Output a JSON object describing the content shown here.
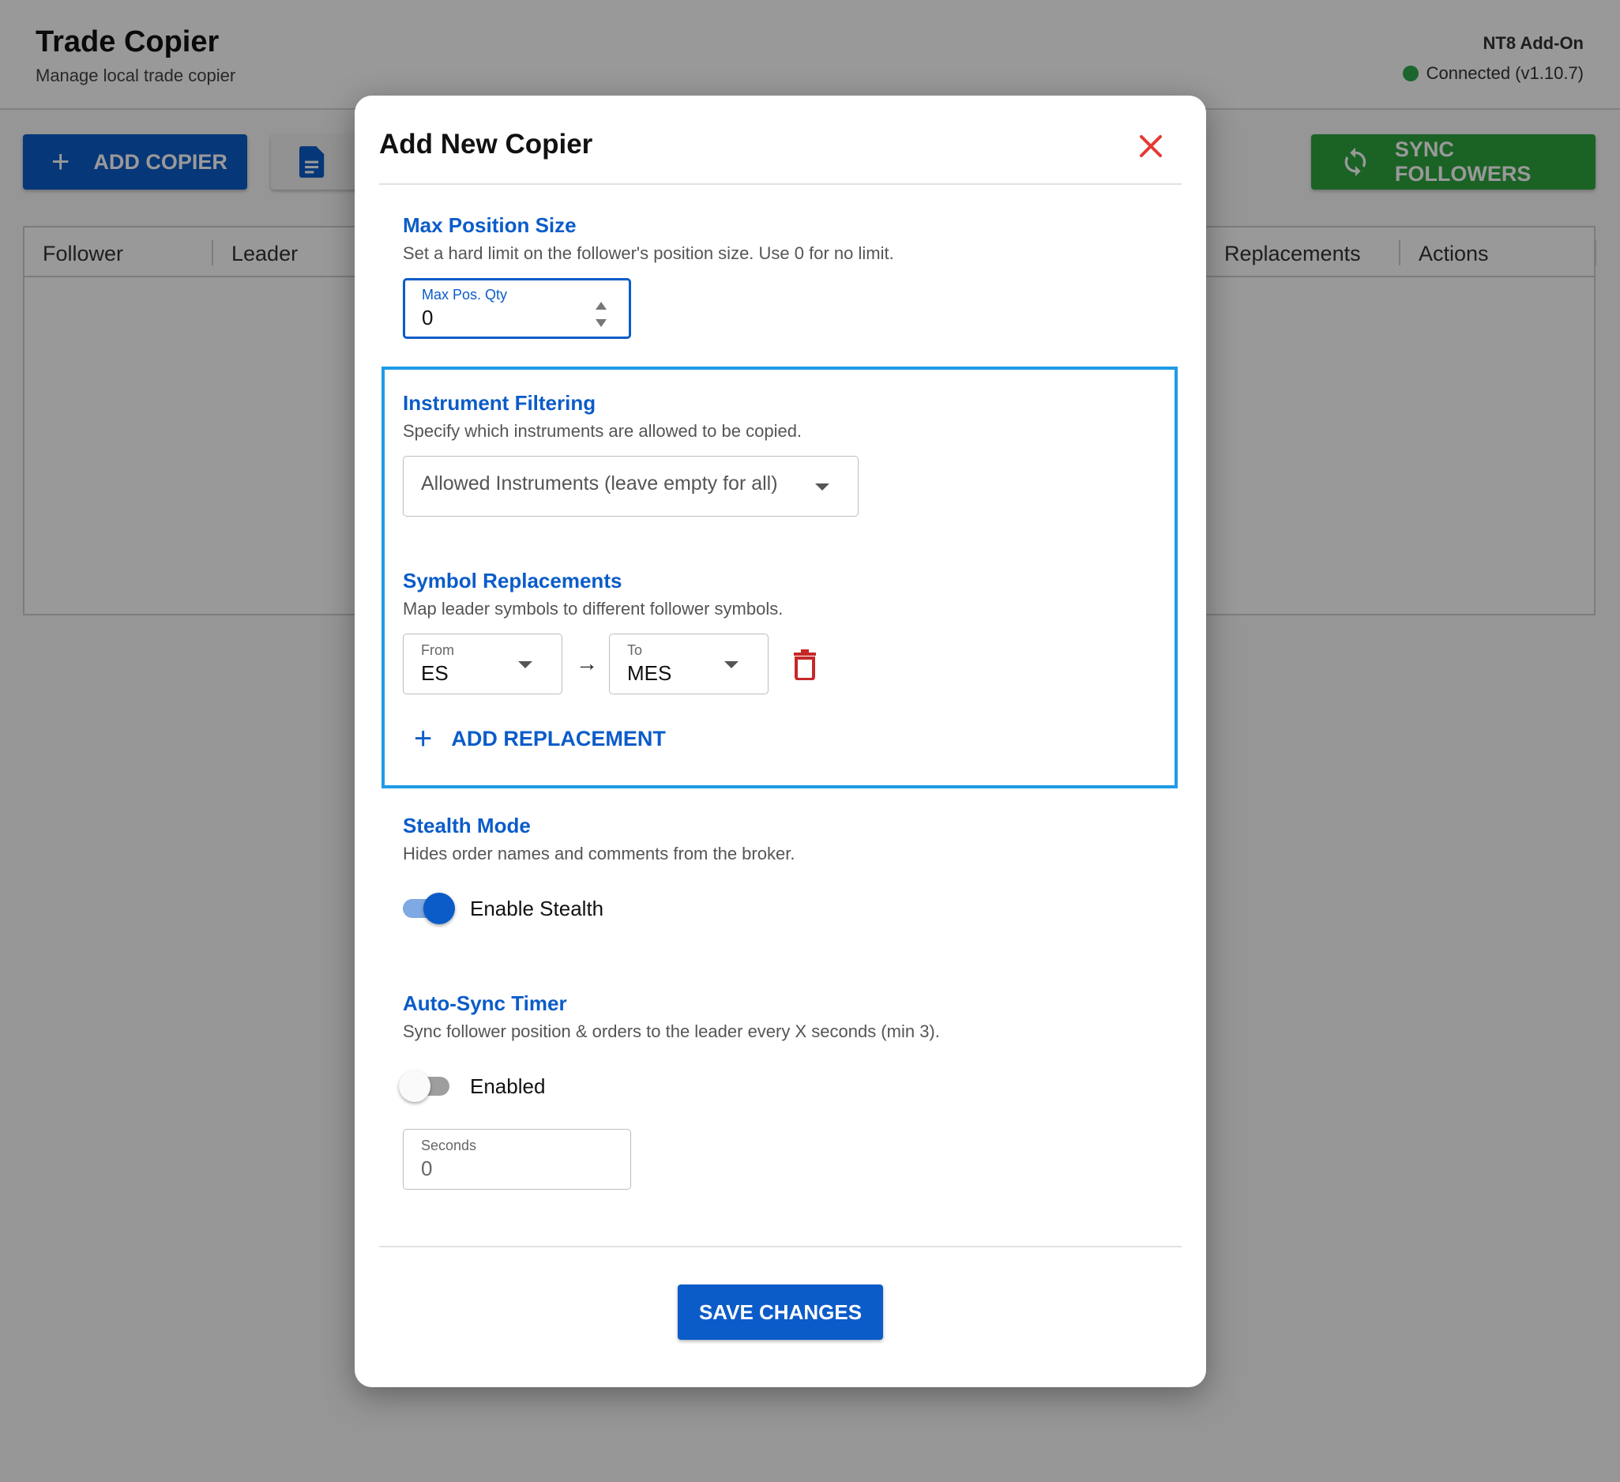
{
  "app": {
    "title": "Trade Copier",
    "subtitle": "Manage local trade copier",
    "addon_label": "NT8 Add-On",
    "status_text": "Connected (v1.10.7)",
    "status_color": "#2fa84f"
  },
  "toolbar": {
    "add_copier_label": "ADD COPIER",
    "sync_followers_label": "SYNC FOLLOWERS"
  },
  "table": {
    "columns": [
      "Follower",
      "Leader",
      "Replacements",
      "Actions"
    ]
  },
  "modal": {
    "title": "Add New Copier",
    "max_position": {
      "title": "Max Position Size",
      "description": "Set a hard limit on the follower's position size. Use 0 for no limit.",
      "field_label": "Max Pos. Qty",
      "value": "0"
    },
    "instrument_filtering": {
      "title": "Instrument Filtering",
      "description": "Specify which instruments are allowed to be copied.",
      "placeholder": "Allowed Instruments (leave empty for all)"
    },
    "symbol_replacements": {
      "title": "Symbol Replacements",
      "description": "Map leader symbols to different follower symbols.",
      "from_label": "From",
      "from_value": "ES",
      "arrow": "→",
      "to_label": "To",
      "to_value": "MES",
      "add_label": "ADD REPLACEMENT"
    },
    "stealth_mode": {
      "title": "Stealth Mode",
      "description": "Hides order names and comments from the broker.",
      "toggle_label": "Enable Stealth",
      "enabled": true
    },
    "auto_sync": {
      "title": "Auto-Sync Timer",
      "description": "Sync follower position & orders to the leader every X seconds (min 3).",
      "toggle_label": "Enabled",
      "enabled": false,
      "seconds_label": "Seconds",
      "seconds_value": "0"
    },
    "save_label": "SAVE CHANGES"
  },
  "colors": {
    "primary": "#0b5cc9",
    "success": "#2ea43e",
    "danger": "#d32f2f",
    "highlight": "#1e9be6"
  }
}
